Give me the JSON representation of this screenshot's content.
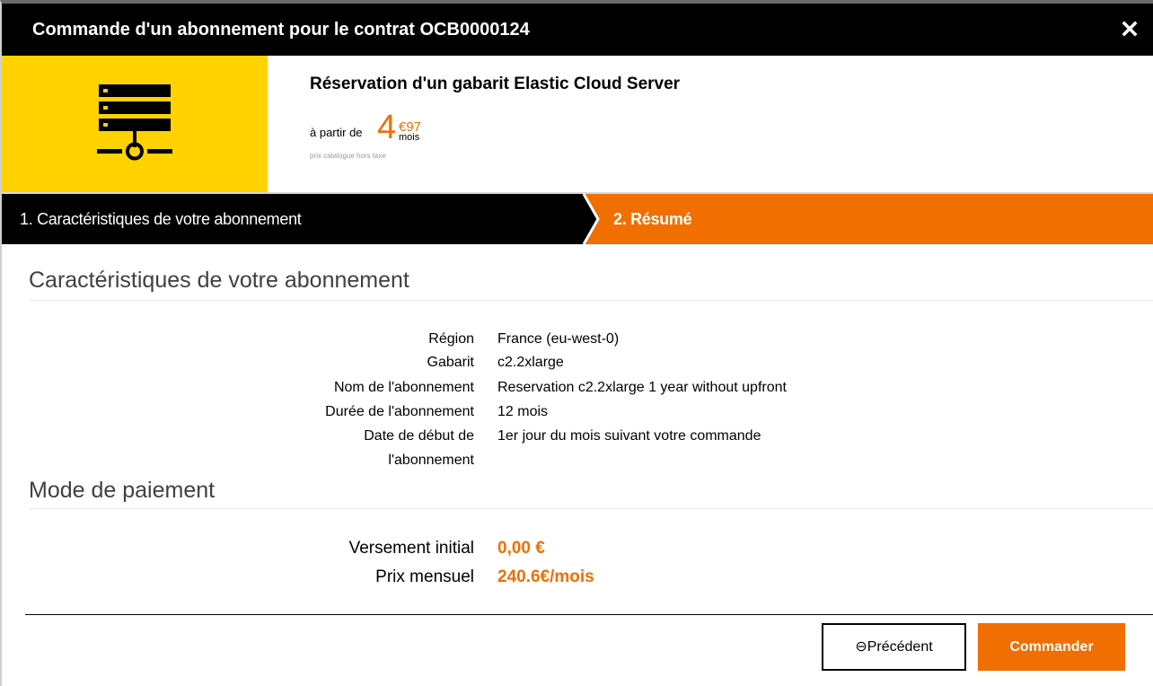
{
  "dialog": {
    "title": "Commande d'un abonnement pour le contrat OCB0000124",
    "close_icon": "close-icon"
  },
  "product": {
    "icon": "server-network-icon",
    "icon_bg_color": "#ffd200",
    "name": "Réservation d'un gabarit Elastic Cloud Server",
    "price_prefix": "à partir de",
    "price_integer": "4",
    "price_cents": "€97",
    "price_unit": "mois",
    "price_note": "prix catalogue hors taxe"
  },
  "steps": [
    {
      "label": "1. Caractéristiques de votre abonnement",
      "active": false
    },
    {
      "label": "2. Résumé",
      "active": true
    }
  ],
  "characteristics": {
    "title": "Caractéristiques de votre abonnement",
    "rows": [
      {
        "label": "Région",
        "value": "France (eu-west-0)"
      },
      {
        "label": "Gabarit",
        "value": "c2.2xlarge"
      },
      {
        "label": "Nom de l'abonnement",
        "value": "Reservation c2.2xlarge 1 year without upfront"
      },
      {
        "label": "Durée de l'abonnement",
        "value": "12 mois"
      },
      {
        "label_line1": "Date de début de",
        "label_line2": "l'abonnement",
        "value": "1er jour du mois suivant votre commande"
      }
    ]
  },
  "payment": {
    "title": "Mode de paiement",
    "rows": [
      {
        "label": "Versement initial",
        "value": "0,00 €"
      },
      {
        "label": "Prix mensuel",
        "value": "240.6€/mois"
      }
    ]
  },
  "buttons": {
    "previous": "⊖Précédent",
    "order": "Commander"
  },
  "colors": {
    "accent": "#f16e00",
    "brand_yellow": "#ffd200",
    "dark": "#000000"
  }
}
